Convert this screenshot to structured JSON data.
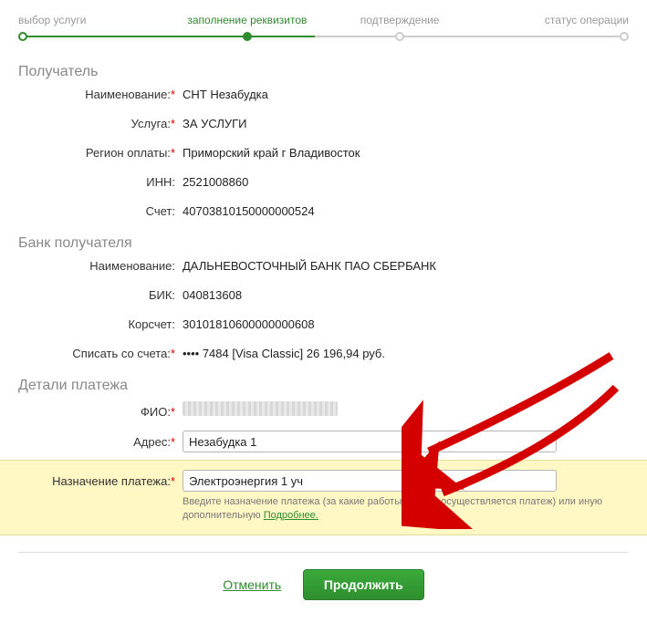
{
  "stepper": {
    "steps": [
      {
        "label": "выбор услуги"
      },
      {
        "label": "заполнение реквизитов"
      },
      {
        "label": "подтверждение"
      },
      {
        "label": "статус операции"
      }
    ]
  },
  "sections": {
    "recipient_title": "Получатель",
    "bank_title": "Банк получателя",
    "details_title": "Детали платежа"
  },
  "labels": {
    "name": "Наименование:",
    "service": "Услуга:",
    "region": "Регион оплаты:",
    "inn": "ИНН:",
    "account": "Счет:",
    "bank_name": "Наименование:",
    "bik": "БИК:",
    "corr": "Корсчет:",
    "from_account": "Списать со счета:",
    "fio": "ФИО:",
    "address": "Адрес:",
    "purpose": "Назначение платежа:"
  },
  "values": {
    "name": "СНТ Незабудка",
    "service": "ЗА УСЛУГИ",
    "region": "Приморский край г Владивосток",
    "inn": "2521008860",
    "account": "40703810150000000524",
    "bank_name": "ДАЛЬНЕВОСТОЧНЫЙ БАНК ПАО СБЕРБАНК",
    "bik": "040813608",
    "corr": "30101810600000000608",
    "from_account": "•••• 7484  [Visa Classic] 26 196,94  руб.",
    "address": "Незабудка 1",
    "purpose": "Электроэнергия 1 уч"
  },
  "hint": {
    "text": "Введите назначение платежа (за какие работы/товары осуществляется платеж) или иную дополнительную ",
    "link": "Подробнее."
  },
  "actions": {
    "cancel": "Отменить",
    "submit": "Продолжить"
  }
}
